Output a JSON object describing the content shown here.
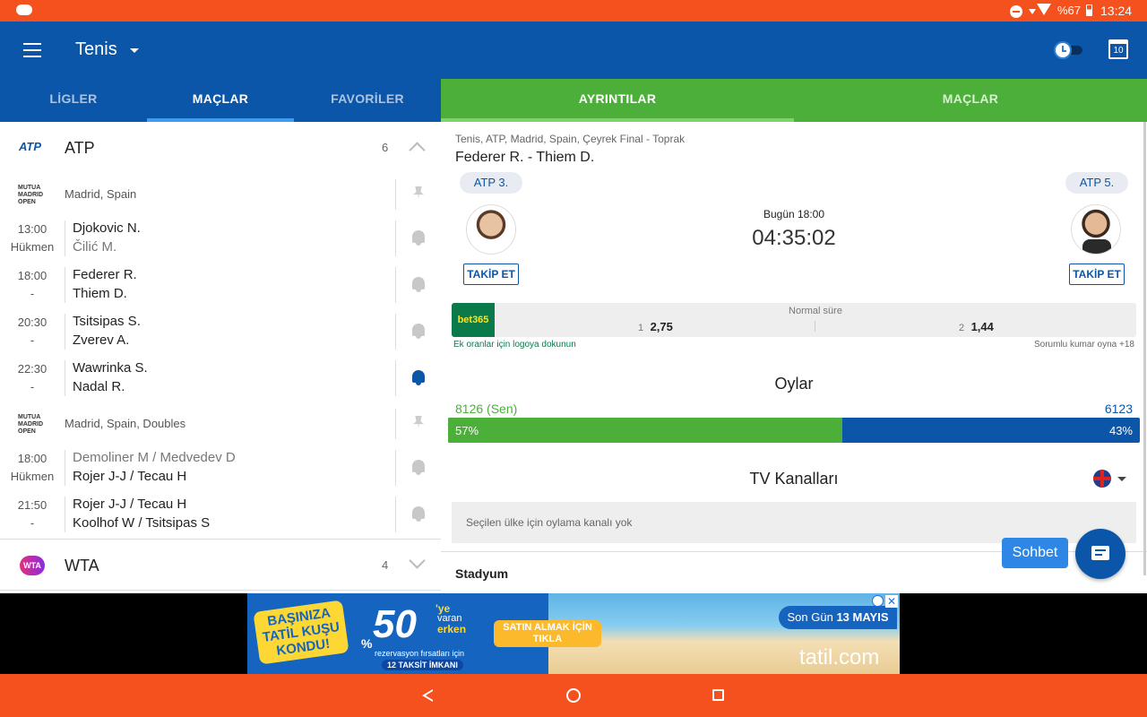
{
  "status": {
    "battery": "%67",
    "time": "13:24"
  },
  "appbar": {
    "title": "Tenis"
  },
  "left_tabs": [
    "LİGLER",
    "MAÇLAR",
    "FAVORİLER"
  ],
  "right_tabs": [
    "AYRINTILAR",
    "MAÇLAR"
  ],
  "league_atp": {
    "logo": "ATP",
    "name": "ATP",
    "count": "6"
  },
  "tournament1": {
    "location": "Madrid, Spain"
  },
  "matches1": [
    {
      "time": "13:00",
      "status": "Hükmen",
      "p1": "Djokovic N.",
      "p2": "Čilić M."
    },
    {
      "time": "18:00",
      "status": "-",
      "p1": "Federer R.",
      "p2": "Thiem D."
    },
    {
      "time": "20:30",
      "status": "-",
      "p1": "Tsitsipas S.",
      "p2": "Zverev A."
    },
    {
      "time": "22:30",
      "status": "-",
      "p1": "Wawrinka S.",
      "p2": "Nadal R."
    }
  ],
  "tournament2": {
    "location": "Madrid, Spain, Doubles"
  },
  "matches2": [
    {
      "time": "18:00",
      "status": "Hükmen",
      "p1": "Demoliner M / Medvedev D",
      "p2": "Rojer J-J / Tecau H"
    },
    {
      "time": "21:50",
      "status": "-",
      "p1": "Rojer J-J / Tecau H",
      "p2": "Koolhof W / Tsitsipas S"
    }
  ],
  "tournament_logo_text": [
    "MUTUA",
    "MADRID",
    "OPEN"
  ],
  "league_wta": {
    "logo": "WTA",
    "name": "WTA",
    "count": "4"
  },
  "detail": {
    "breadcrumb": "Tenis, ATP, Madrid, Spain, Çeyrek Final - Toprak",
    "title": "Federer R. - Thiem D.",
    "rank_left": "ATP 3.",
    "rank_right": "ATP 5.",
    "date": "Bugün 18:00",
    "countdown": "04:35:02",
    "follow": "TAKİP ET",
    "bookmaker": "bet365",
    "odds_label": "Normal süre",
    "odd1_label": "1",
    "odd1": "2,75",
    "odd2_label": "2",
    "odd2": "1,44",
    "odds_hint": "Ek oranlar için logoya dokunun",
    "responsible": "Sorumlu kumar oyna +18",
    "votes_title": "Oylar",
    "votes_left": "8126 (Sen)",
    "votes_right": "6123",
    "pct_left": "57%",
    "pct_right": "43%",
    "vote_share_left": 0.57,
    "tv_title": "TV Kanalları",
    "tv_empty": "Seçilen ülke için oylama kanalı yok",
    "stadium": "Stadyum",
    "chat": "Sohbet"
  },
  "ad": {
    "headline": "BAŞINIZA TATİL KUŞU KONDU!",
    "number": "50",
    "suffix1": "'ye",
    "suffix2": "varan",
    "suffix3": "erken",
    "percent": "%",
    "subline": "rezervasyon fırsatları için",
    "installments": "12 TAKSİT İMKANI",
    "cta": "SATIN ALMAK İÇİN TIKLA",
    "lastday": "Son Gün",
    "date": "13 MAYIS",
    "brand": "tatil.com"
  },
  "colors": {
    "blue": "#0b56a8",
    "green": "#4caf3a",
    "orange": "#f4511e"
  }
}
